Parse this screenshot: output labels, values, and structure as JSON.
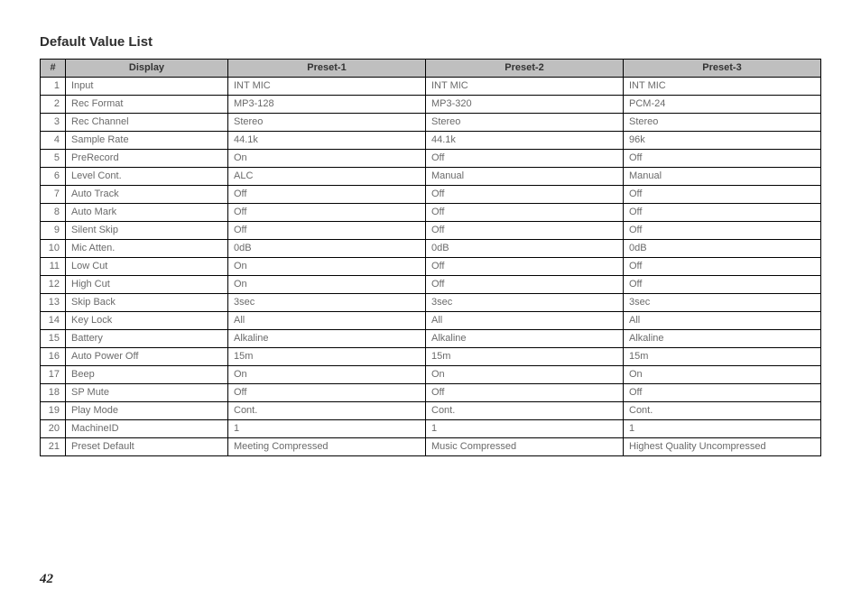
{
  "title": "Default Value List",
  "page_number": "42",
  "headers": {
    "num": "#",
    "display": "Display",
    "preset1": "Preset-1",
    "preset2": "Preset-2",
    "preset3": "Preset-3"
  },
  "rows": [
    {
      "n": "1",
      "display": "Input",
      "p1": "INT MIC",
      "p2": "INT MIC",
      "p3": "INT MIC"
    },
    {
      "n": "2",
      "display": "Rec Format",
      "p1": "MP3-128",
      "p2": "MP3-320",
      "p3": "PCM-24"
    },
    {
      "n": "3",
      "display": "Rec Channel",
      "p1": "Stereo",
      "p2": "Stereo",
      "p3": "Stereo"
    },
    {
      "n": "4",
      "display": "Sample Rate",
      "p1": "44.1k",
      "p2": "44.1k",
      "p3": "96k"
    },
    {
      "n": "5",
      "display": "PreRecord",
      "p1": "On",
      "p2": "Off",
      "p3": "Off"
    },
    {
      "n": "6",
      "display": "Level Cont.",
      "p1": "ALC",
      "p2": "Manual",
      "p3": "Manual"
    },
    {
      "n": "7",
      "display": "Auto Track",
      "p1": "Off",
      "p2": "Off",
      "p3": "Off"
    },
    {
      "n": "8",
      "display": "Auto Mark",
      "p1": "Off",
      "p2": "Off",
      "p3": "Off"
    },
    {
      "n": "9",
      "display": "Silent Skip",
      "p1": "Off",
      "p2": "Off",
      "p3": "Off"
    },
    {
      "n": "10",
      "display": "Mic Atten.",
      "p1": "0dB",
      "p2": "0dB",
      "p3": "0dB"
    },
    {
      "n": "11",
      "display": "Low Cut",
      "p1": "On",
      "p2": "Off",
      "p3": "Off"
    },
    {
      "n": "12",
      "display": "High Cut",
      "p1": "On",
      "p2": "Off",
      "p3": "Off"
    },
    {
      "n": "13",
      "display": "Skip Back",
      "p1": "3sec",
      "p2": "3sec",
      "p3": "3sec"
    },
    {
      "n": "14",
      "display": "Key Lock",
      "p1": "All",
      "p2": "All",
      "p3": "All"
    },
    {
      "n": "15",
      "display": "Battery",
      "p1": "Alkaline",
      "p2": "Alkaline",
      "p3": "Alkaline"
    },
    {
      "n": "16",
      "display": "Auto Power Off",
      "p1": "15m",
      "p2": "15m",
      "p3": "15m"
    },
    {
      "n": "17",
      "display": "Beep",
      "p1": "On",
      "p2": "On",
      "p3": "On"
    },
    {
      "n": "18",
      "display": "SP Mute",
      "p1": "Off",
      "p2": "Off",
      "p3": "Off"
    },
    {
      "n": "19",
      "display": "Play Mode",
      "p1": "Cont.",
      "p2": "Cont.",
      "p3": "Cont."
    },
    {
      "n": "20",
      "display": "MachineID",
      "p1": "1",
      "p2": "1",
      "p3": "1"
    },
    {
      "n": "21",
      "display": "Preset Default",
      "p1": "Meeting Compressed",
      "p2": "Music Compressed",
      "p3": "Highest Quality Uncompressed"
    }
  ]
}
